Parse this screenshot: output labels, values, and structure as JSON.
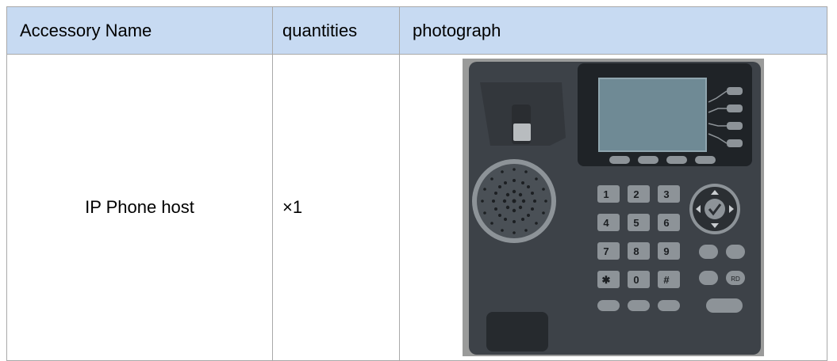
{
  "table": {
    "headers": [
      "Accessory Name",
      "quantities",
      "photograph"
    ],
    "rows": [
      {
        "name": "IP Phone host",
        "quantity": "×1",
        "photo_alt": ""
      }
    ]
  },
  "phone_keys": {
    "digits": [
      "1",
      "2",
      "3",
      "4",
      "5",
      "6",
      "7",
      "8",
      "9",
      "✱",
      "0",
      "#"
    ],
    "function_keys": [
      "RD"
    ]
  },
  "colors": {
    "header_bg": "#c7daf2",
    "border": "#a9a9a9",
    "phone_body": "#3d4248",
    "screen": "#6f8a95"
  }
}
